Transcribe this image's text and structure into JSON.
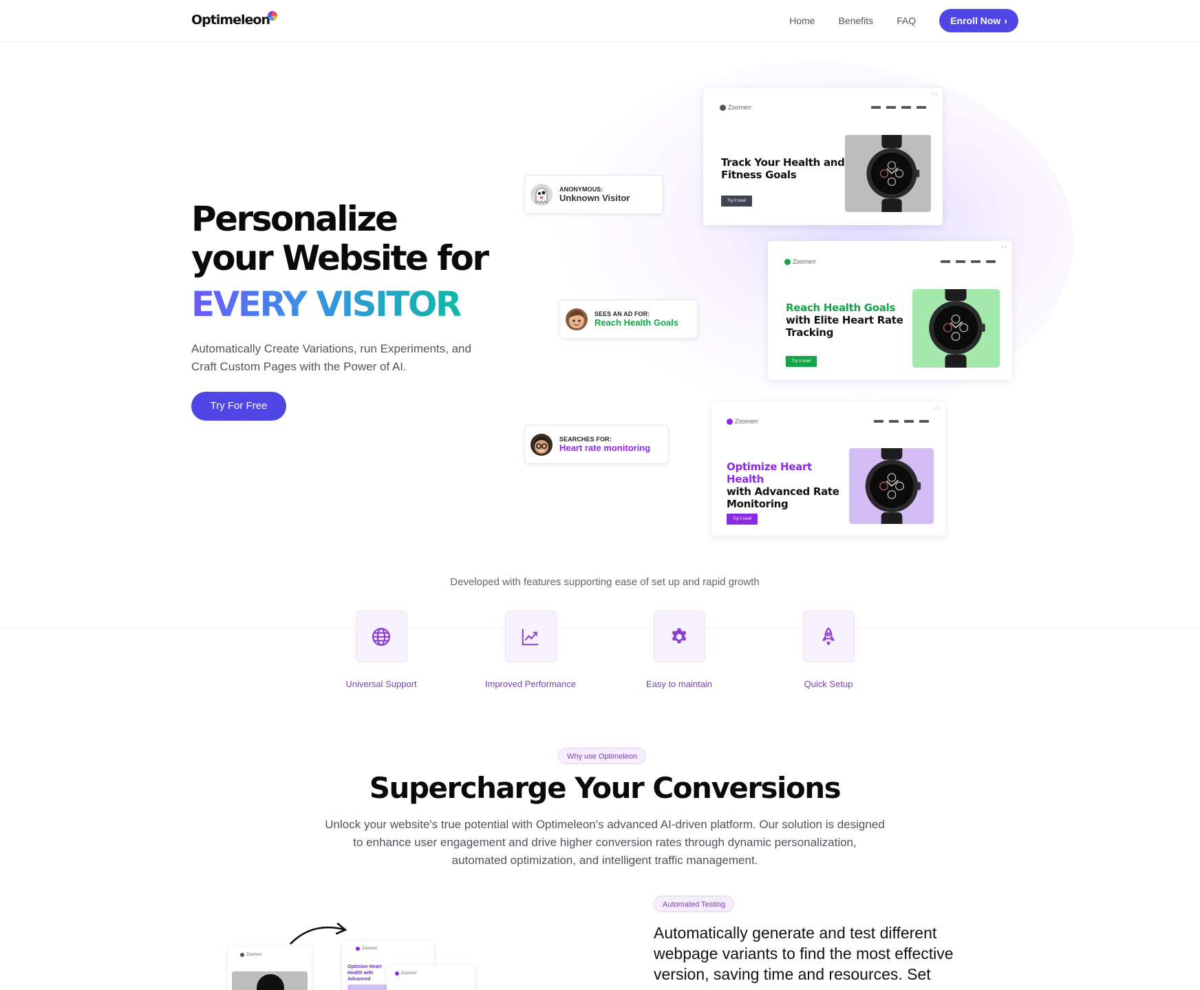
{
  "brand": {
    "name": "Optimeleon"
  },
  "nav": {
    "links": [
      "Home",
      "Benefits",
      "FAQ"
    ],
    "cta": "Enroll Now",
    "cta_arrow": "›"
  },
  "hero": {
    "title_line1": "Personalize",
    "title_line2": "your Website for",
    "title_gradient": "EVERY VISITOR",
    "subtitle": "Automatically Create Variations, run Experiments, and Craft Custom Pages with the Power of AI.",
    "cta": "Try For Free"
  },
  "visitors": [
    {
      "label": "ANONYMOUS:",
      "value": "Unknown Visitor",
      "color": "#333333"
    },
    {
      "label": "SEES AN AD FOR:",
      "value": "Reach Health Goals",
      "color": "#16a34a"
    },
    {
      "label": "SEARCHES FOR:",
      "value": "Heart rate monitoring",
      "color": "#8a2be2"
    }
  ],
  "mocks": [
    {
      "brand": "Zoomerr",
      "heading_hl": "",
      "heading_rest": "Track Your Health and Fitness Goals",
      "button": "Try it now!",
      "accent": "#3f4452",
      "image_bg": "#bdbdbd"
    },
    {
      "brand": "Zoomerr",
      "heading_hl": "Reach Health Goals",
      "heading_rest": "with Elite Heart Rate Tracking",
      "button": "Try it now!",
      "accent": "#16a34a",
      "image_bg": "#a5e8ac"
    },
    {
      "brand": "Zoomerr",
      "heading_hl": "Optimize Heart Health",
      "heading_rest": "with Advanced Rate Monitoring",
      "button": "Try it now!",
      "accent": "#8a2be2",
      "image_bg": "#d4bcf5"
    }
  ],
  "features": {
    "intro": "Developed with features supporting ease of set up and rapid growth",
    "items": [
      {
        "label": "Universal Support",
        "icon": "globe-icon"
      },
      {
        "label": "Improved Performance",
        "icon": "chart-line-icon"
      },
      {
        "label": "Easy to maintain",
        "icon": "gear-icon"
      },
      {
        "label": "Quick Setup",
        "icon": "rocket-icon"
      }
    ]
  },
  "why": {
    "pill": "Why use Optimeleon",
    "title": "Supercharge Your Conversions",
    "subtitle": "Unlock your website's true potential with Optimeleon's advanced AI-driven platform. Our solution is designed to enhance user engagement and drive higher conversion rates through dynamic personalization, automated optimization, and intelligent traffic management."
  },
  "automated": {
    "pill": "Automated Testing",
    "text": "Automatically generate and test different webpage variants to find the most effective version, saving time and resources. Set",
    "mini_brand": "Zoomerr",
    "mini_heading": "Optimize Heart Health with Advanced"
  },
  "colors": {
    "primary": "#4f46e5",
    "purple": "#8a2be2",
    "green": "#16a34a"
  }
}
